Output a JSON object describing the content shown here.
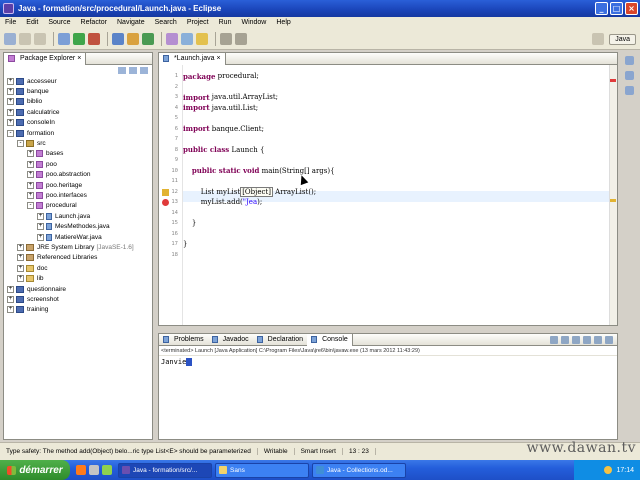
{
  "window": {
    "title": "Java - formation/src/procedural/Launch.java - Eclipse"
  },
  "menu": [
    "File",
    "Edit",
    "Source",
    "Refactor",
    "Navigate",
    "Search",
    "Project",
    "Run",
    "Window",
    "Help"
  ],
  "perspectives": [
    "Java"
  ],
  "package_explorer": {
    "tab_label": "Package Explorer",
    "tree": [
      {
        "label": "accesseur",
        "type": "project",
        "twisty": "+",
        "level": 0
      },
      {
        "label": "banque",
        "type": "project",
        "twisty": "+",
        "level": 0
      },
      {
        "label": "biblio",
        "type": "project",
        "twisty": "+",
        "level": 0
      },
      {
        "label": "calculatrice",
        "type": "project",
        "twisty": "+",
        "level": 0
      },
      {
        "label": "consoleIn",
        "type": "project",
        "twisty": "+",
        "level": 0
      },
      {
        "label": "formation",
        "type": "project",
        "twisty": "-",
        "level": 0
      },
      {
        "label": "src",
        "type": "src",
        "twisty": "-",
        "level": 1
      },
      {
        "label": "bases",
        "type": "pkg",
        "twisty": "+",
        "level": 2
      },
      {
        "label": "poo",
        "type": "pkg",
        "twisty": "+",
        "level": 2
      },
      {
        "label": "poo.abstraction",
        "type": "pkg",
        "twisty": "+",
        "level": 2
      },
      {
        "label": "poo.heritage",
        "type": "pkg",
        "twisty": "+",
        "level": 2
      },
      {
        "label": "poo.interfaces",
        "type": "pkg",
        "twisty": "+",
        "level": 2
      },
      {
        "label": "procedural",
        "type": "pkg",
        "twisty": "-",
        "level": 2
      },
      {
        "label": "Launch.java",
        "type": "java",
        "twisty": "+",
        "level": 3
      },
      {
        "label": "MesMethodes.java",
        "type": "java",
        "twisty": "+",
        "level": 3
      },
      {
        "label": "MatiereWar.java",
        "type": "java",
        "twisty": "+",
        "level": 3
      },
      {
        "label": "JRE System Library",
        "type": "lib",
        "twisty": "+",
        "level": 1,
        "extra": "[JavaSE-1.6]"
      },
      {
        "label": "Referenced Libraries",
        "type": "lib",
        "twisty": "+",
        "level": 1
      },
      {
        "label": "doc",
        "type": "folder",
        "twisty": "+",
        "level": 1
      },
      {
        "label": "lib",
        "type": "folder",
        "twisty": "+",
        "level": 1
      },
      {
        "label": "questionnaire",
        "type": "project",
        "twisty": "+",
        "level": 0
      },
      {
        "label": "screenshot",
        "type": "project",
        "twisty": "+",
        "level": 0
      },
      {
        "label": "training",
        "type": "project",
        "twisty": "+",
        "level": 0
      }
    ]
  },
  "editor": {
    "tab_label": "*Launch.java",
    "lines": [
      {
        "n": "1",
        "parts": [
          {
            "k": "kw",
            "t": "package"
          },
          {
            "t": " procedural;"
          }
        ]
      },
      {
        "n": "2",
        "parts": []
      },
      {
        "n": "3",
        "parts": [
          {
            "k": "kw",
            "t": "import"
          },
          {
            "t": " java.util.ArrayList;"
          }
        ]
      },
      {
        "n": "4",
        "parts": [
          {
            "k": "kw",
            "t": "import"
          },
          {
            "t": " java.util.List;"
          }
        ]
      },
      {
        "n": "5",
        "parts": []
      },
      {
        "n": "6",
        "parts": [
          {
            "k": "kw",
            "t": "import"
          },
          {
            "t": " banque.Client;"
          }
        ]
      },
      {
        "n": "7",
        "parts": []
      },
      {
        "n": "8",
        "parts": [
          {
            "k": "kw",
            "t": "public class"
          },
          {
            "t": " Launch {"
          }
        ]
      },
      {
        "n": "9",
        "parts": []
      },
      {
        "n": "10",
        "parts": [
          {
            "t": "    "
          },
          {
            "k": "kw",
            "t": "public static void"
          },
          {
            "t": " main(String[] args){"
          }
        ]
      },
      {
        "n": "11",
        "parts": []
      },
      {
        "n": "12",
        "parts": [
          {
            "t": "        List myList"
          },
          {
            "k": "box",
            "t": "[Object]"
          },
          {
            "t": " ArrayList();"
          }
        ]
      },
      {
        "n": "13",
        "parts": [
          {
            "t": "        myList.add("
          },
          {
            "k": "str",
            "t": "\"Jea"
          },
          {
            "t": ");"
          }
        ]
      },
      {
        "n": "14",
        "parts": []
      },
      {
        "n": "15",
        "parts": [
          {
            "t": "    }"
          }
        ]
      },
      {
        "n": "16",
        "parts": []
      },
      {
        "n": "17",
        "parts": [
          {
            "t": "}"
          }
        ]
      },
      {
        "n": "18",
        "parts": []
      }
    ]
  },
  "console": {
    "tabs": [
      "Problems",
      "Javadoc",
      "Declaration",
      "Console"
    ],
    "active_tab": "Console",
    "info": "<terminated> Launch [Java Application] C:\\Program Files\\Java\\jre6\\bin\\javaw.exe (13 mars 2012 11:43:29)",
    "output": "Janvie"
  },
  "status": {
    "message": "Type safety: The method add(Object) belo...ric type List<E> should be parameterized",
    "mode": "Writable",
    "insert": "Smart Insert",
    "position": "13 : 23"
  },
  "watermark": "www.dawan.tv",
  "taskbar": {
    "start_label": "démarrer",
    "tasks": [
      "Java - formation/src/...",
      "Sans",
      "Java - Collections.od..."
    ],
    "clock": "17:14"
  }
}
